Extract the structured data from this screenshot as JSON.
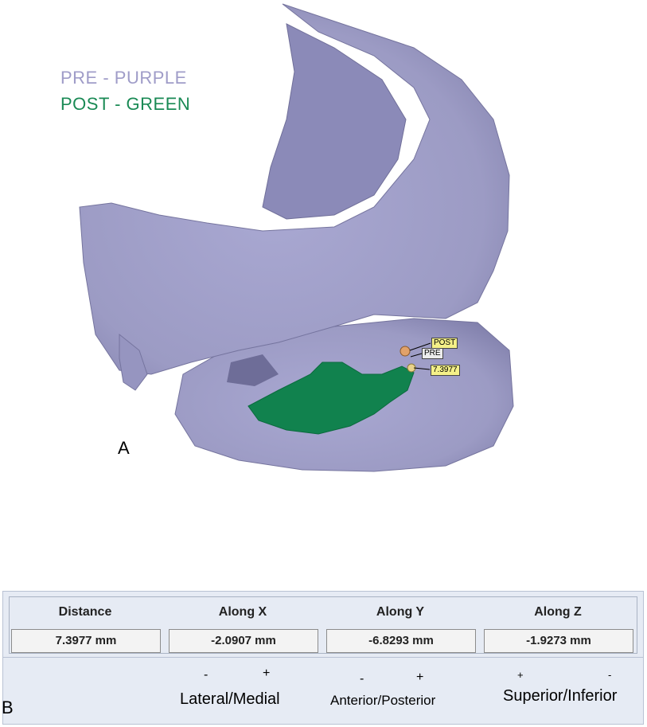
{
  "figure_a": {
    "panel_label": "A",
    "legend": [
      {
        "text": "PRE - PURPLE",
        "color": "#9f9cc8"
      },
      {
        "text": "POST - GREEN",
        "color": "#1a8a55"
      }
    ],
    "callouts": {
      "post": "POST",
      "pre": "PRE",
      "distance": "7.3977"
    },
    "colors": {
      "skull": "#9c9bc4",
      "skull_shadow": "#7f7eaa",
      "implant": "#11824e"
    }
  },
  "figure_b": {
    "panel_label": "B",
    "columns": [
      {
        "header": "Distance",
        "value": "7.3977 mm"
      },
      {
        "header": "Along X",
        "value": "-2.0907 mm"
      },
      {
        "header": "Along Y",
        "value": "-6.8293 mm"
      },
      {
        "header": "Along Z",
        "value": "-1.9273 mm"
      }
    ],
    "axes": [
      {
        "label": "Lateral/Medial",
        "neg": "-",
        "pos": "+"
      },
      {
        "label": "Anterior/Posterior",
        "neg": "-",
        "pos": "+"
      },
      {
        "label": "Superior/Inferior",
        "neg": "+",
        "pos": "-"
      }
    ]
  }
}
